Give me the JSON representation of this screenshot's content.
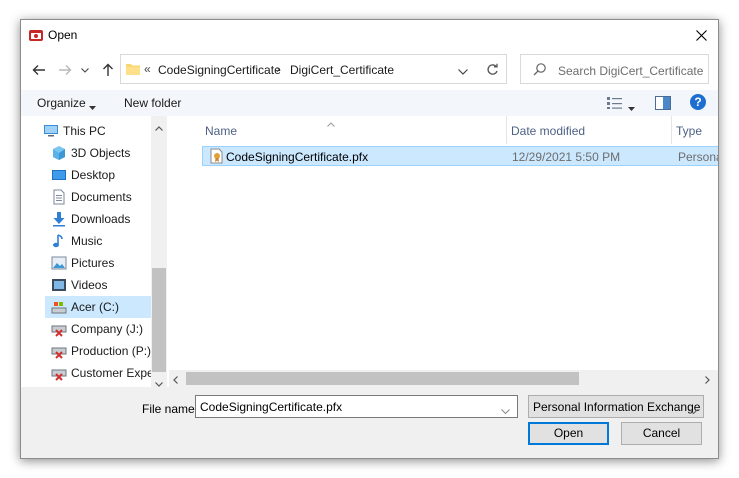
{
  "window": {
    "title": "Open"
  },
  "address": {
    "overflow": "«",
    "crumbs": [
      "CodeSigningCertificate",
      "DigiCert_Certificate"
    ],
    "separator": "›"
  },
  "search": {
    "placeholder": "Search DigiCert_Certificate"
  },
  "toolbar": {
    "organize_label": "Organize",
    "new_folder_label": "New folder",
    "help_label": "?"
  },
  "nav": {
    "items": [
      {
        "label": "This PC",
        "icon": "this-pc-icon"
      },
      {
        "label": "3D Objects",
        "icon": "3d-objects-icon"
      },
      {
        "label": "Desktop",
        "icon": "desktop-icon"
      },
      {
        "label": "Documents",
        "icon": "documents-icon"
      },
      {
        "label": "Downloads",
        "icon": "downloads-icon"
      },
      {
        "label": "Music",
        "icon": "music-icon"
      },
      {
        "label": "Pictures",
        "icon": "pictures-icon"
      },
      {
        "label": "Videos",
        "icon": "videos-icon"
      },
      {
        "label": "Acer (C:)",
        "icon": "drive-icon",
        "selected": true
      },
      {
        "label": "Company (J:)",
        "icon": "network-drive-icon"
      },
      {
        "label": "Production (P:)",
        "icon": "network-drive-icon"
      },
      {
        "label": "Customer Experie",
        "icon": "network-drive-icon"
      }
    ]
  },
  "files": {
    "columns": [
      "Name",
      "Date modified",
      "Type"
    ],
    "rows": [
      {
        "name": "CodeSigningCertificate.pfx",
        "date": "12/29/2021 5:50 PM",
        "type": "Personal Info",
        "icon": "certificate-file-icon",
        "selected": true
      }
    ]
  },
  "bottom": {
    "filename_label": "File name:",
    "filename_value": "CodeSigningCertificate.pfx",
    "filetype_value": "Personal Information Exchange",
    "open_label": "Open",
    "cancel_label": "Cancel"
  },
  "colors": {
    "selection": "#cce8ff",
    "accent": "#0078d7",
    "header_text": "#4d6185"
  }
}
